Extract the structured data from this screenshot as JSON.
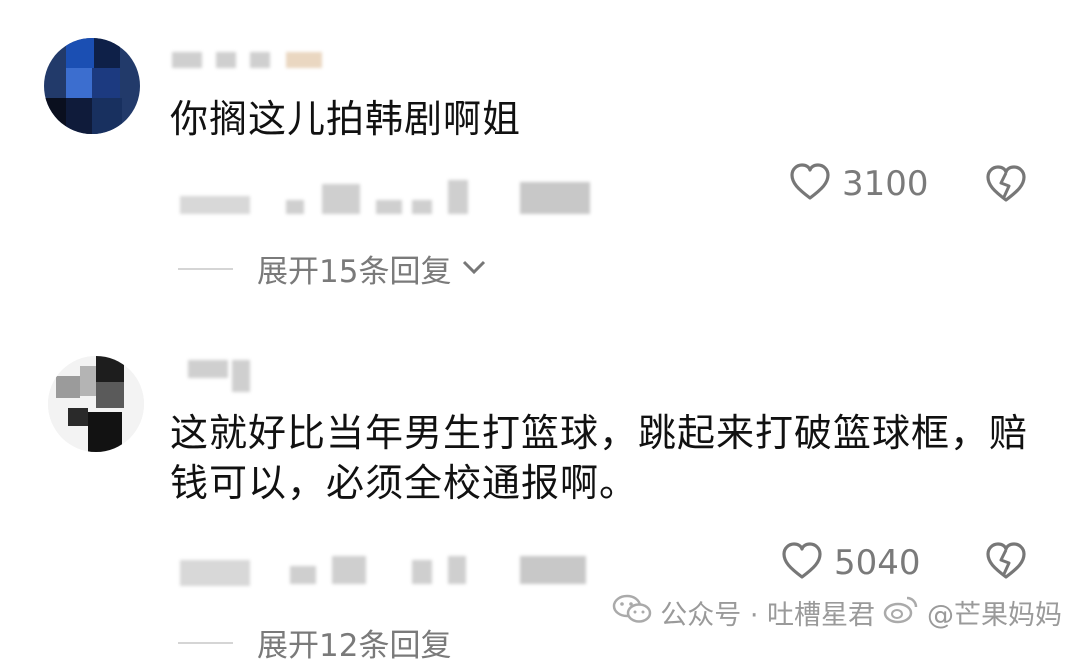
{
  "comments": [
    {
      "text": "你搁这儿拍韩剧啊姐",
      "likes": "3100",
      "expand_label": "展开15条回复"
    },
    {
      "text": "这就好比当年男生打篮球，跳起来打破篮球框，赔钱可以，必须全校通报啊。",
      "likes": "5040",
      "expand_label": "展开12条回复"
    }
  ],
  "watermark": {
    "wechat": "公众号 · 吐槽星君",
    "weibo": "@芒果妈妈"
  },
  "icons": {
    "like": "heart-outline-icon",
    "dislike": "broken-heart-icon",
    "expand": "chevron-down-icon",
    "wechat": "wechat-icon",
    "weibo": "weibo-icon"
  },
  "colors": {
    "text": "#111111",
    "meta": "#7a7a7a",
    "background": "#ffffff"
  }
}
